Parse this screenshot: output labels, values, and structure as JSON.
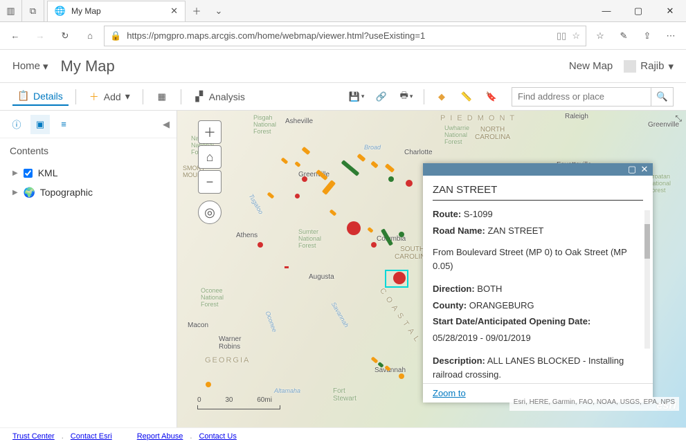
{
  "browser": {
    "tab_title": "My Map",
    "url": "https://pmgpro.maps.arcgis.com/home/webmap/viewer.html?useExisting=1"
  },
  "header": {
    "home": "Home",
    "title": "My Map",
    "new_map": "New Map",
    "user": "Rajib"
  },
  "toolbar": {
    "details": "Details",
    "add": "Add",
    "analysis": "Analysis",
    "search_placeholder": "Find address or place"
  },
  "sidebar": {
    "heading": "Contents",
    "layers": [
      {
        "name": "KML",
        "icon": "kml"
      },
      {
        "name": "Topographic",
        "icon": "basemap"
      }
    ]
  },
  "map": {
    "labels": {
      "piedmont": "P I E D M O N T",
      "nc": "NORTH\nCAROLINA",
      "sc": "SOUTH\nCAROLINA",
      "georgia": "GEORGIA",
      "coastal": "C O A S T A L",
      "raleigh": "Raleigh",
      "fayetteville": "Fayetteville",
      "greenville_nc": "Greenville",
      "charlotte": "Charlotte",
      "asheville": "Asheville",
      "greenville_sc": "Greenville",
      "columbia": "Columbia",
      "augusta": "Augusta",
      "athens": "Athens",
      "savannah": "Savannah",
      "macon": "Macon",
      "warner": "Warner\nRobins",
      "fort": "Fort\nStewart",
      "pisgah": "Pisgah\nNational\nForest",
      "nantahala": "Nantahala\nNational\nForest",
      "sumter": "Sumter\nNational\nForest",
      "oconee": "Oconee\nNational\nForest",
      "uwharrie": "Uwharrie\nNational\nForest",
      "croatan": "Croatan\nNational\nForest",
      "altamaha": "Altamaha",
      "broad": "Broad",
      "tugaloo": "Tugaloo",
      "savannah_r": "Savannah",
      "oconee_r": "Oconee",
      "smoky": "SMOKY\nMOUNTAINS"
    },
    "scale": {
      "left": "0",
      "mid": "30",
      "right": "60mi"
    },
    "attribution": "Esri, HERE, Garmin, FAO, NOAA, USGS, EPA, NPS",
    "esri": "esri"
  },
  "popup": {
    "title": "ZAN STREET",
    "route_lbl": "Route:",
    "route": "S-1099",
    "road_lbl": "Road Name:",
    "road": "ZAN STREET",
    "segment": "From Boulevard Street (MP 0) to Oak Street (MP 0.05)",
    "dir_lbl": "Direction:",
    "dir": "BOTH",
    "county_lbl": "County:",
    "county": "ORANGEBURG",
    "date_lbl": "Start Date/Anticipated Opening Date:",
    "date": "05/28/2019 - 09/01/2019",
    "desc_lbl": "Description:",
    "desc": "ALL LANES BLOCKED - Installing railroad crossing.",
    "zoom": "Zoom to"
  },
  "footer": {
    "trust": "Trust Center",
    "contact_esri": "Contact Esri",
    "report": "Report Abuse",
    "contact_us": "Contact Us"
  }
}
